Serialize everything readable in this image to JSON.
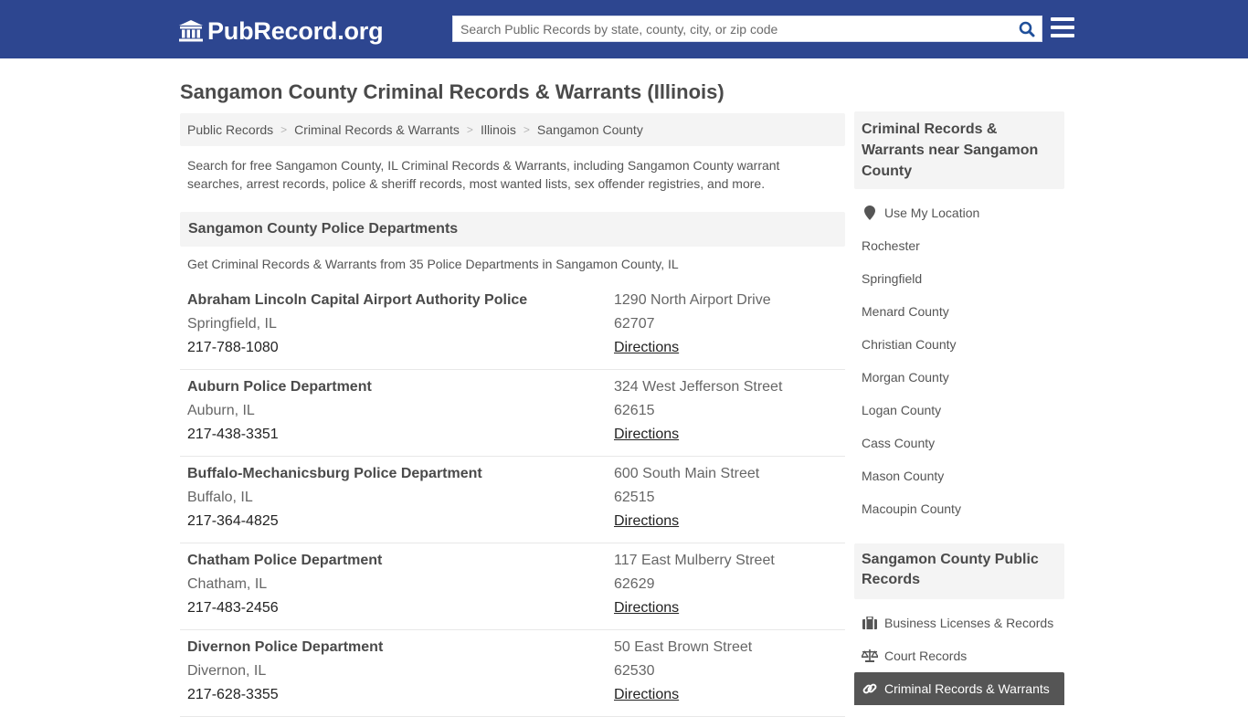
{
  "header": {
    "logo_text": "PubRecord.org",
    "search_placeholder": "Search Public Records by state, county, city, or zip code",
    "search_value": "",
    "brand_color": "#2d4690",
    "search_icon_color": "#1f4f9a"
  },
  "page": {
    "title": "Sangamon County Criminal Records & Warrants (Illinois)",
    "breadcrumb": [
      {
        "label": "Public Records"
      },
      {
        "label": "Criminal Records & Warrants"
      },
      {
        "label": "Illinois"
      },
      {
        "label": "Sangamon County"
      }
    ],
    "intro": "Search for free Sangamon County, IL Criminal Records & Warrants, including Sangamon County warrant searches, arrest records, police & sheriff records, most wanted lists, sex offender registries, and more."
  },
  "main": {
    "section_title": "Sangamon County Police Departments",
    "section_subtitle": "Get Criminal Records & Warrants from 35 Police Departments in Sangamon County, IL",
    "departments": [
      {
        "name": "Abraham Lincoln Capital Airport Authority Police",
        "city": "Springfield, IL",
        "phone": "217-788-1080",
        "address": "1290 North Airport Drive",
        "zip": "62707",
        "directions": "Directions"
      },
      {
        "name": "Auburn Police Department",
        "city": "Auburn, IL",
        "phone": "217-438-3351",
        "address": "324 West Jefferson Street",
        "zip": "62615",
        "directions": "Directions"
      },
      {
        "name": "Buffalo-Mechanicsburg Police Department",
        "city": "Buffalo, IL",
        "phone": "217-364-4825",
        "address": "600 South Main Street",
        "zip": "62515",
        "directions": "Directions"
      },
      {
        "name": "Chatham Police Department",
        "city": "Chatham, IL",
        "phone": "217-483-2456",
        "address": "117 East Mulberry Street",
        "zip": "62629",
        "directions": "Directions"
      },
      {
        "name": "Divernon Police Department",
        "city": "Divernon, IL",
        "phone": "217-628-3355",
        "address": "50 East Brown Street",
        "zip": "62530",
        "directions": "Directions"
      }
    ]
  },
  "sidebar": {
    "nearby_title": "Criminal Records & Warrants near Sangamon County",
    "use_location": {
      "label": "Use My Location",
      "icon": "map-marker-icon"
    },
    "nearby": [
      {
        "label": "Rochester"
      },
      {
        "label": "Springfield"
      },
      {
        "label": "Menard County"
      },
      {
        "label": "Christian County"
      },
      {
        "label": "Morgan County"
      },
      {
        "label": "Logan County"
      },
      {
        "label": "Cass County"
      },
      {
        "label": "Mason County"
      },
      {
        "label": "Macoupin County"
      }
    ],
    "records_title": "Sangamon County Public Records",
    "records": [
      {
        "label": "Business Licenses & Records",
        "icon": "briefcase-icon",
        "active": false
      },
      {
        "label": "Court Records",
        "icon": "scales-icon",
        "active": false
      },
      {
        "label": "Criminal Records & Warrants",
        "icon": "link-icon",
        "active": true
      }
    ]
  }
}
